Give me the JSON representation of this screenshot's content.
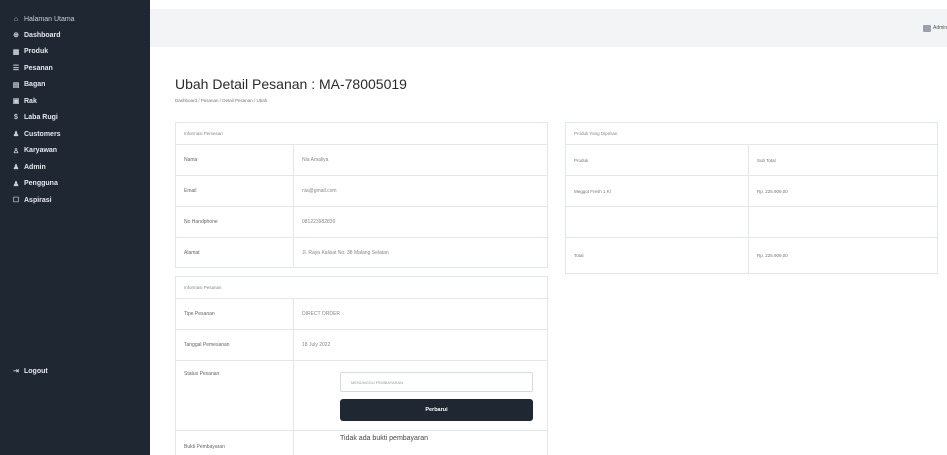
{
  "sidebar": {
    "home": "Halaman Utama",
    "items": [
      {
        "icon": "⊕",
        "label": "Dashboard"
      },
      {
        "icon": "▦",
        "label": "Produk"
      },
      {
        "icon": "☰",
        "label": "Pesanan"
      },
      {
        "icon": "▤",
        "label": "Bagan"
      },
      {
        "icon": "▣",
        "label": "Rak"
      },
      {
        "icon": "$",
        "label": "Laba Rugi"
      },
      {
        "icon": "♟",
        "label": "Customers"
      },
      {
        "icon": "♙",
        "label": "Karyawan"
      },
      {
        "icon": "♟",
        "label": "Admin"
      },
      {
        "icon": "♟",
        "label": "Pengguna"
      },
      {
        "icon": "☐",
        "label": "Aspirasi"
      }
    ],
    "logout": "Logout"
  },
  "header": {
    "user_label": "Admin"
  },
  "page": {
    "title": "Ubah Detail Pesanan : MA-78005019",
    "breadcrumb": "Dashboard / Pesanan / Detail Pesanan / Ubah"
  },
  "customer_card": {
    "header": "Informasi Pemesan",
    "rows": [
      {
        "label": "Nama",
        "value": "Nia Amaliya"
      },
      {
        "label": "Email",
        "value": "nia@gmail.com"
      },
      {
        "label": "No Handphone",
        "value": "081223982830"
      },
      {
        "label": "Alamat",
        "value": "Jl. Raya Kalisat No. 38 Malang Selatan"
      }
    ]
  },
  "order_card": {
    "header": "Informasi Pesanan",
    "rows": [
      {
        "label": "Tipe Pesanan",
        "value": "DIRECT ORDER"
      },
      {
        "label": "Tanggal Pemesanan",
        "value": "18 July 2022"
      }
    ],
    "status_label": "Status Pesanan",
    "status_value": "MENUNGGU PEMBAYARAN",
    "update_button": "Perbarui",
    "proof_label": "Bukti Pembayaran",
    "proof_value": "Tidak ada bukti pembayaran"
  },
  "products_card": {
    "header": "Produk Yang Dipesan",
    "columns": [
      "Produk",
      "Sub Total"
    ],
    "rows": [
      {
        "product": "Meggot Fresh 1 Kl",
        "subtotal": "Rp. 225.909,00"
      },
      {
        "product": "",
        "subtotal": ""
      }
    ],
    "total_label": "Total",
    "total_value": "Rp. 225.909,00"
  }
}
